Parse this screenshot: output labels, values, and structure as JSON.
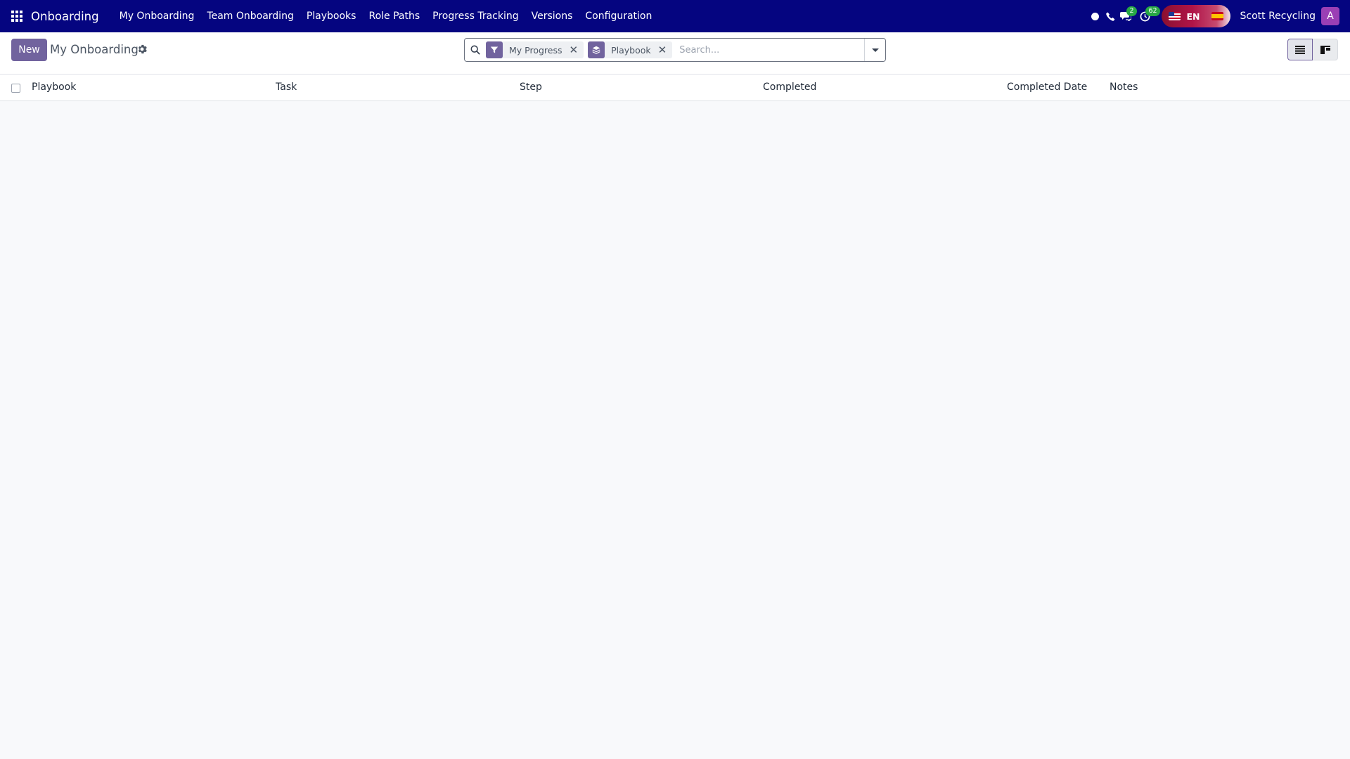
{
  "navbar": {
    "app_name": "Onboarding",
    "menu": [
      {
        "label": "My Onboarding"
      },
      {
        "label": "Team Onboarding"
      },
      {
        "label": "Playbooks"
      },
      {
        "label": "Role Paths"
      },
      {
        "label": "Progress Tracking"
      },
      {
        "label": "Versions"
      },
      {
        "label": "Configuration"
      }
    ],
    "messages_badge": "2",
    "activities_badge": "62",
    "language": "EN",
    "company": "Scott Recycling",
    "avatar_initial": "A"
  },
  "control_panel": {
    "new_label": "New",
    "breadcrumb": "My Onboarding",
    "search": {
      "facets": [
        {
          "type": "filter",
          "label": "My Progress",
          "icon": "filter-icon"
        },
        {
          "type": "group",
          "label": "Playbook",
          "icon": "layers-icon"
        }
      ],
      "placeholder": "Search..."
    },
    "views": [
      "list-view-icon",
      "kanban-view-icon"
    ],
    "active_view": "list"
  },
  "table": {
    "columns": [
      "Playbook",
      "Task",
      "Step",
      "Completed",
      "Completed Date",
      "Notes"
    ],
    "rows": []
  },
  "colors": {
    "navbar": "#050580",
    "accent": "#71639e",
    "badge": "#28a745",
    "avatar": "#9b3fb5"
  }
}
